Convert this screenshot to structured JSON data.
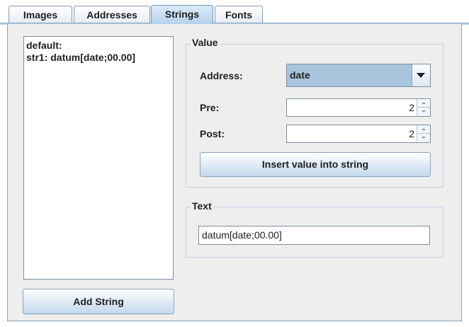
{
  "tabs": [
    {
      "label": "Images"
    },
    {
      "label": "Addresses"
    },
    {
      "label": "Strings"
    },
    {
      "label": "Fonts"
    }
  ],
  "active_tab": "Strings",
  "strings_list": {
    "items": [
      {
        "label": "default:"
      },
      {
        "label": "str1: datum[date;00.00]"
      }
    ]
  },
  "add_string_button": "Add String",
  "value_group": {
    "title": "Value",
    "address_label": "Address:",
    "address_value": "date",
    "pre_label": "Pre:",
    "pre_value": "2",
    "post_label": "Post:",
    "post_value": "2",
    "insert_button": "Insert value into string"
  },
  "text_group": {
    "title": "Text",
    "value": "datum[date;00.00]"
  },
  "colors": {
    "active_tab": "#b6d3ec",
    "combo_bg": "#a9c5de",
    "panel_bg": "#eeeeee",
    "border": "#8aa2bc"
  }
}
